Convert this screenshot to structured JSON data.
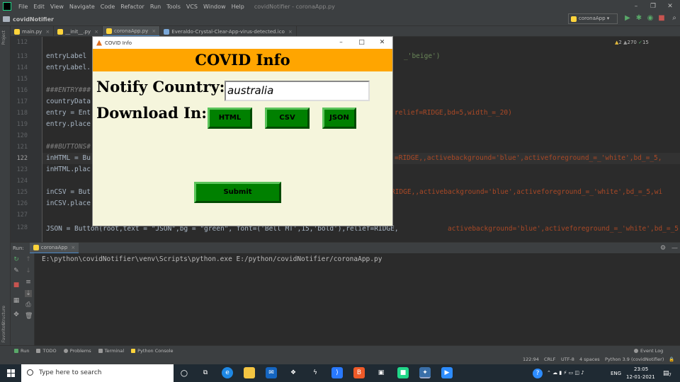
{
  "ide": {
    "menu": [
      "File",
      "Edit",
      "View",
      "Navigate",
      "Code",
      "Refactor",
      "Run",
      "Tools",
      "VCS",
      "Window",
      "Help"
    ],
    "window_title": "covidNotifier - coronaApp.py",
    "project": "covidNotifier",
    "run_config": "coronaApp",
    "tabs": [
      "main.py",
      "__init__.py",
      "coronaApp.py",
      "Everaldo-Crystal-Clear-App-virus-detected.ico"
    ],
    "inspection_warnings": "2",
    "inspection_weak": "270",
    "inspection_typos": "15",
    "side_labels": {
      "project": "Project",
      "structure": "Structure",
      "favorites": "Favorites"
    }
  },
  "editor": {
    "line_numbers": [
      "112",
      "113",
      "114",
      "115",
      "116",
      "117",
      "118",
      "119",
      "120",
      "121",
      "122",
      "123",
      "124",
      "125",
      "126",
      "127",
      "128"
    ],
    "lines": {
      "l113_a": "entryLabel",
      "l113_b": "_'beige')",
      "l114": "entryLabel.",
      "l116": "###ENTRY###",
      "l117": "countryData",
      "l118_a": "entry = Ent",
      "l118_b": "relief=RIDGE,bd=5,width_=_20)",
      "l119": "entry.place",
      "l121": "###BUTTONS#",
      "l122_a": "inHTML = Bu",
      "l122_b": "=RIDGE,,activebackground='blue',activeforeground_=_'white',bd_=_5,",
      "l123": "inHTML.plac",
      "l125_a": "inCSV = But",
      "l125_b": "RIDGE,,activebackground='blue',activeforeground_=_'white',bd_=_5,wi",
      "l126": "inCSV.place",
      "l128_a": "JSON = Button(root,text = \"JSON\",bg = \"green\", font=('Bell MT',15,'bold'),relief=RIDGE,",
      "l128_b": "activebackground='blue',activeforeground_=_'white',bd_=_5,wid"
    }
  },
  "tk_window": {
    "title": "COVID Info",
    "header": "COVID Info",
    "notify_label": "Notify Country:",
    "country_value": "australia",
    "download_label": "Download In:",
    "btn_html": "HTML",
    "btn_csv": "CSV",
    "btn_json": "JSON",
    "btn_submit": "Submit"
  },
  "run_panel": {
    "label": "Run:",
    "config": "coronaApp",
    "console_text": "E:\\python\\covidNotifier\\venv\\Scripts\\python.exe E:/python/covidNotifier/coronaApp.py"
  },
  "tool_windows": [
    "Run",
    "TODO",
    "Problems",
    "Terminal",
    "Python Console"
  ],
  "event_log": "Event Log",
  "status": {
    "position": "122:94",
    "line_sep": "CRLF",
    "encoding": "UTF-8",
    "indent": "4 spaces",
    "interpreter": "Python 3.9 (covidNotifier)"
  },
  "taskbar": {
    "search_placeholder": "Type here to search",
    "lang": "ENG",
    "time": "23:05",
    "date": "12-01-2021",
    "notifications": "7"
  },
  "colors": {
    "tk_bg": "#f5f5dc",
    "tk_header": "#ffa500",
    "tk_button": "#008000",
    "ide_bg": "#2b2b2b"
  }
}
